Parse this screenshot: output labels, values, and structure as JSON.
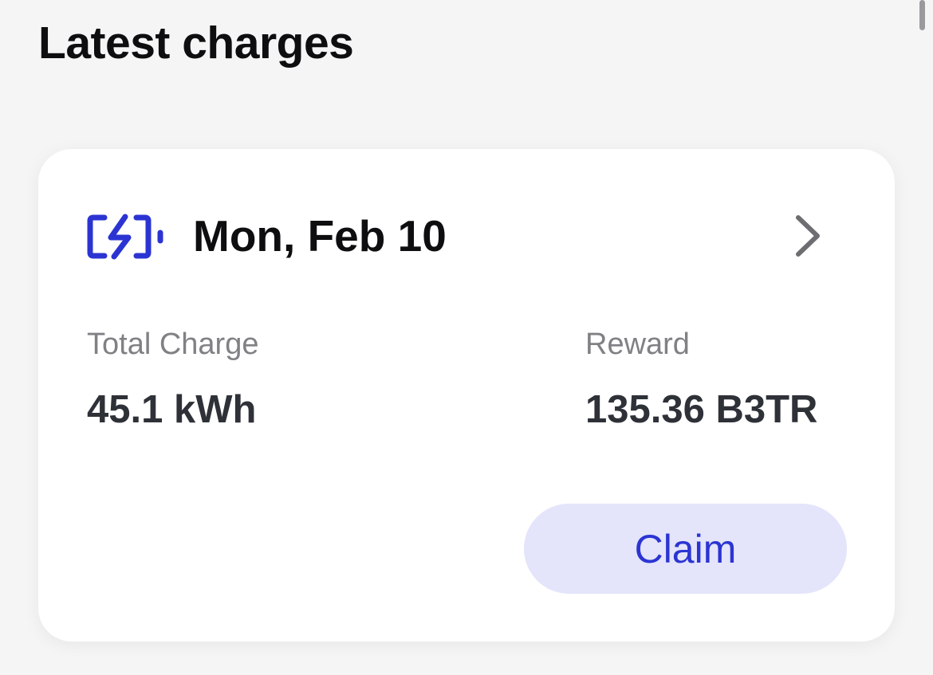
{
  "section": {
    "title": "Latest charges"
  },
  "charge_card": {
    "icon": "battery-charging-icon",
    "date": "Mon, Feb 10",
    "total_charge": {
      "label": "Total Charge",
      "value": "45.1 kWh"
    },
    "reward": {
      "label": "Reward",
      "value": "135.36 B3TR"
    },
    "claim_label": "Claim"
  },
  "colors": {
    "accent": "#2b34d2",
    "claim_background": "#e4e4fb",
    "page_background": "#f5f5f6"
  }
}
